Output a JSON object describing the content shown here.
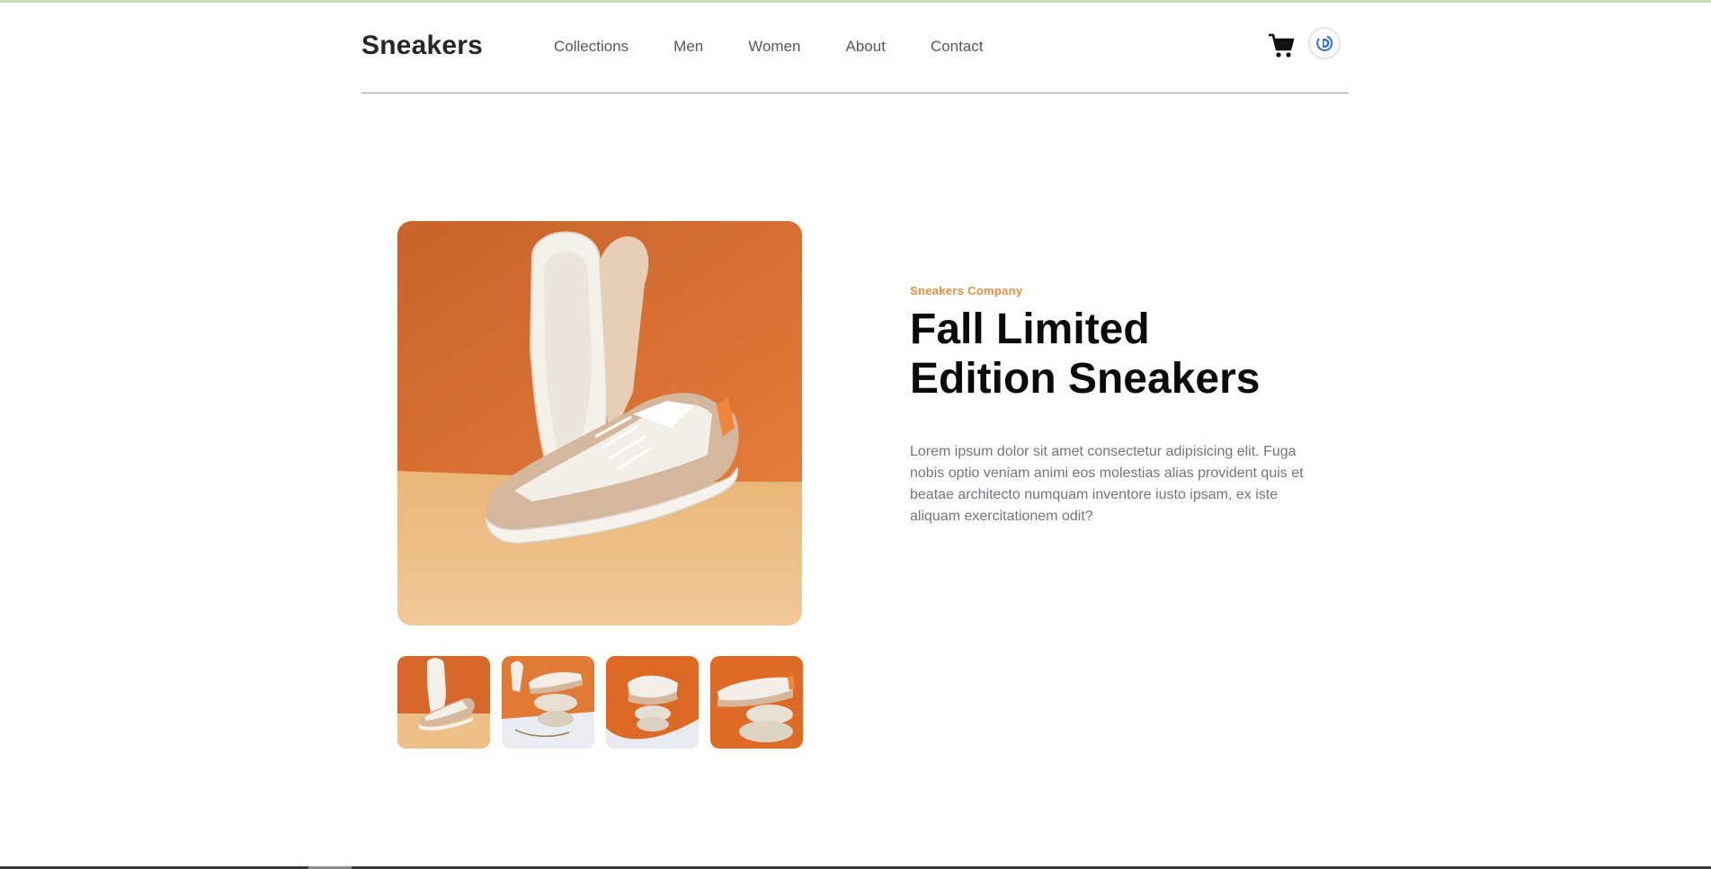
{
  "brand": {
    "name": "Sneakers"
  },
  "nav": {
    "items": [
      {
        "label": "Collections"
      },
      {
        "label": "Men"
      },
      {
        "label": "Women"
      },
      {
        "label": "About"
      },
      {
        "label": "Contact"
      }
    ]
  },
  "header_icons": {
    "cart": "cart-icon",
    "avatar": "user-avatar"
  },
  "product": {
    "company": "Sneakers Company",
    "title": "Fall Limited Edition Sneakers",
    "description": "Lorem ipsum dolor sit amet consectetur adipisicing elit. Fuga nobis optio veniam animi eos molestias alias provident quis et beatae architecto numquam inventore iusto ipsam, ex iste aliquam exercitationem odit?",
    "thumbnail_count": 4
  },
  "colors": {
    "accent": "#f08c3a",
    "heading": "#0b0b0b",
    "text": "#72757c",
    "background_orange": "#d9651f"
  }
}
